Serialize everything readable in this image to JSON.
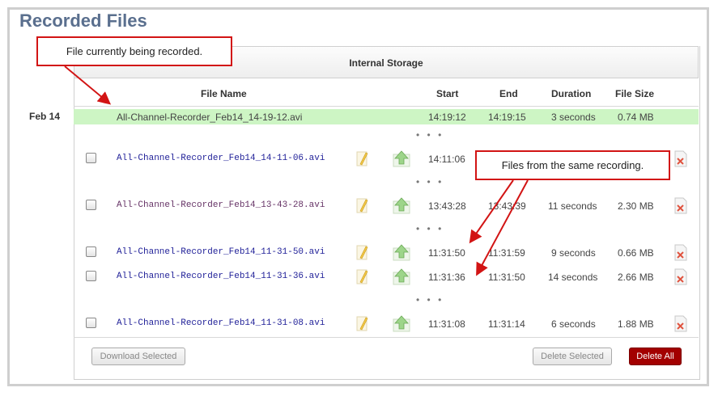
{
  "page": {
    "title": "Recorded Files"
  },
  "storage": {
    "label": "Internal Storage"
  },
  "columns": {
    "file_name": "File Name",
    "start": "Start",
    "end": "End",
    "duration": "Duration",
    "file_size": "File Size"
  },
  "date_group": "Feb 14",
  "active_recording": {
    "name": "All-Channel-Recorder_Feb14_14-19-12.avi",
    "start": "14:19:12",
    "end": "14:19:15",
    "duration": "3 seconds",
    "size": "0.74 MB"
  },
  "separator": "• • •",
  "rows": [
    {
      "name": "All-Channel-Recorder_Feb14_14-11-06.avi",
      "start": "14:11:06",
      "end": "",
      "duration": "",
      "size": ""
    },
    {
      "name": "All-Channel-Recorder_Feb14_13-43-28.avi",
      "start": "13:43:28",
      "end": "13:43:39",
      "duration": "11 seconds",
      "size": "2.30 MB"
    },
    {
      "name": "All-Channel-Recorder_Feb14_11-31-50.avi",
      "start": "11:31:50",
      "end": "11:31:59",
      "duration": "9 seconds",
      "size": "0.66 MB"
    },
    {
      "name": "All-Channel-Recorder_Feb14_11-31-36.avi",
      "start": "11:31:36",
      "end": "11:31:50",
      "duration": "14 seconds",
      "size": "2.66 MB"
    },
    {
      "name": "All-Channel-Recorder_Feb14_11-31-08.avi",
      "start": "11:31:08",
      "end": "11:31:14",
      "duration": "6 seconds",
      "size": "1.88 MB"
    }
  ],
  "buttons": {
    "download_selected": "Download Selected",
    "delete_selected": "Delete Selected",
    "delete_all": "Delete All"
  },
  "callouts": {
    "current": "File currently being recorded.",
    "same": "Files from the same recording."
  },
  "icons": {
    "edit": "pencil-icon",
    "upload": "upload-arrow-icon",
    "delete": "delete-file-icon"
  },
  "colors": {
    "title": "#5a6f8e",
    "active_row": "#cdf5c4",
    "link": "#222299",
    "delete_all": "#a30000",
    "callout_border": "#d21414"
  }
}
